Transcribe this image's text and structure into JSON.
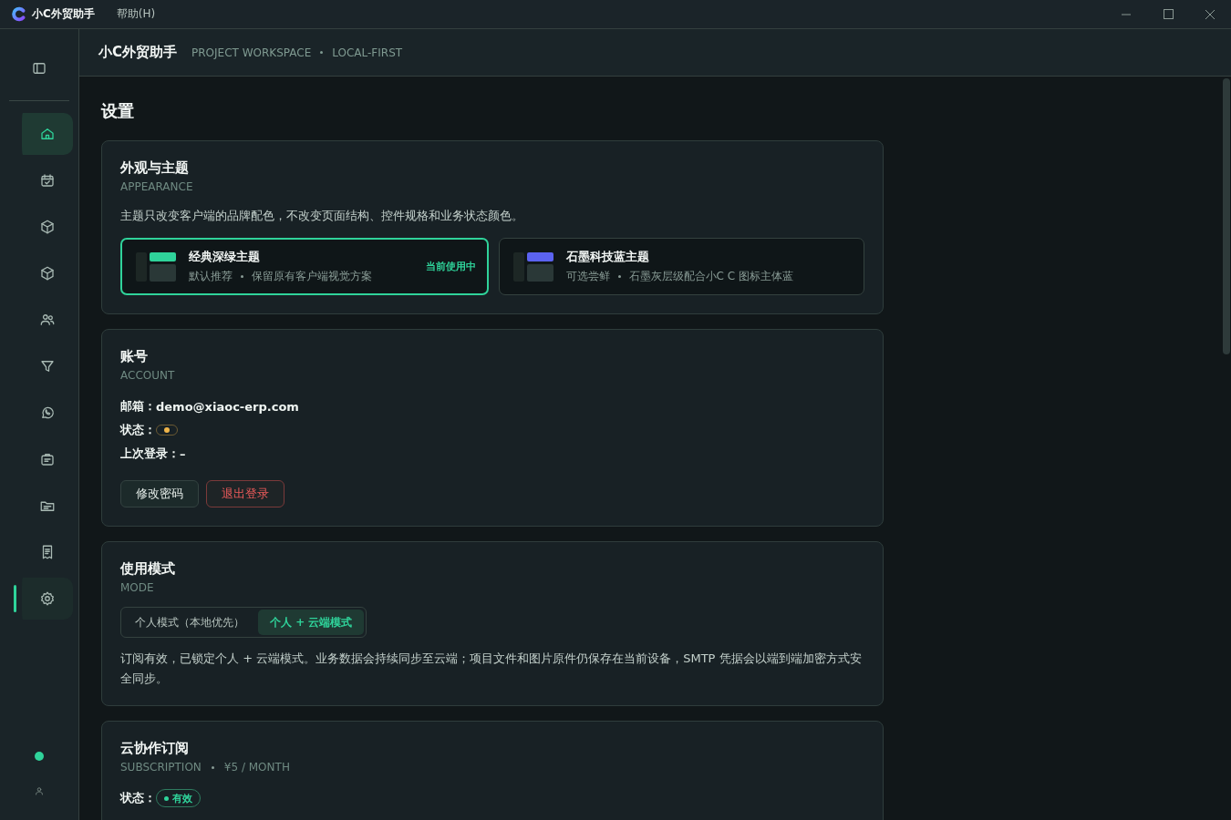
{
  "window": {
    "app_name": "小C外贸助手",
    "menu": [
      {
        "label": "帮助(H)"
      }
    ]
  },
  "sidebar": {
    "items": [
      {
        "kind": "home",
        "selected": false,
        "highlighted": true
      },
      {
        "kind": "calendar",
        "selected": false,
        "highlighted": false
      },
      {
        "kind": "box",
        "selected": false,
        "highlighted": false
      },
      {
        "kind": "box",
        "selected": false,
        "highlighted": false
      },
      {
        "kind": "users",
        "selected": false,
        "highlighted": false
      },
      {
        "kind": "funnel",
        "selected": false,
        "highlighted": false
      },
      {
        "kind": "chat",
        "selected": false,
        "highlighted": false
      },
      {
        "kind": "briefcase",
        "selected": false,
        "highlighted": false
      },
      {
        "kind": "folder",
        "selected": false,
        "highlighted": false
      },
      {
        "kind": "receipt",
        "selected": false,
        "highlighted": false
      },
      {
        "kind": "gear",
        "selected": true,
        "highlighted": false
      }
    ],
    "status_dot": {
      "color": "#2fd39a"
    }
  },
  "header": {
    "title": "小C外贸助手",
    "subtitle": "PROJECT WORKSPACE",
    "tag": "LOCAL-FIRST"
  },
  "page_title": "设置",
  "appearance": {
    "title": "外观与主题",
    "caption": "APPEARANCE",
    "description": "主题只改变客户端的品牌配色，不改变页面结构、控件规格和业务状态颜色。",
    "themes": [
      {
        "name": "经典深绿主题",
        "note": "默认推荐",
        "detail": "保留原有客户端视觉方案",
        "color": "#2fd39a",
        "selected": true,
        "badge": "当前使用中"
      },
      {
        "name": "石墨科技蓝主题",
        "note": "可选尝鲜",
        "detail": "石墨灰层级配合小C C 图标主体蓝",
        "color": "#5b63f0",
        "selected": false
      }
    ]
  },
  "account": {
    "title": "账号",
    "caption": "ACCOUNT",
    "fields": [
      {
        "kind": "text",
        "label": "邮箱：",
        "value": "demo@xiaoc-erp.com"
      },
      {
        "kind": "status",
        "label": "状态：",
        "color": "#f0b54a"
      },
      {
        "kind": "text",
        "label": "上次登录：",
        "value": "–"
      }
    ],
    "buttons": [
      {
        "label": "修改密码",
        "kind": "normal"
      },
      {
        "label": "退出登录",
        "kind": "danger"
      }
    ]
  },
  "mode": {
    "title": "使用模式",
    "caption": "MODE",
    "options": [
      {
        "label": "个人模式（本地优先）",
        "selected": false
      },
      {
        "label": "个人 + 云端模式",
        "selected": true
      }
    ],
    "description": "订阅有效，已锁定个人 + 云端模式。业务数据会持续同步至云端；项目文件和图片原件仍保存在当前设备，SMTP 凭据会以端到端加密方式安全同步。"
  },
  "subscription": {
    "title": "云协作订阅",
    "caption": "SUBSCRIPTION",
    "price": "¥5 / MONTH",
    "status_label": "状态：",
    "status": "有效"
  }
}
